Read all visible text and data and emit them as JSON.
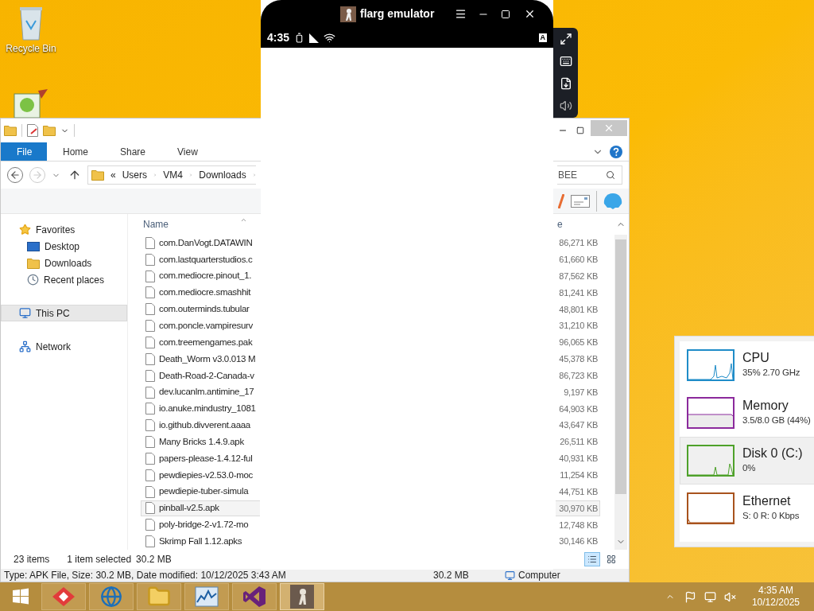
{
  "desktop": {
    "icons": [
      {
        "label": "Recycle Bin"
      }
    ]
  },
  "explorer": {
    "ribbon_tabs": [
      {
        "label": "File",
        "selected": true
      },
      {
        "label": "Home",
        "selected": false
      },
      {
        "label": "Share",
        "selected": false
      },
      {
        "label": "View",
        "selected": false
      }
    ],
    "address": {
      "overflow": "«",
      "parts": [
        "Users",
        "VM4",
        "Downloads"
      ]
    },
    "search": {
      "value": "BEE"
    },
    "nav": [
      {
        "label": "Favorites",
        "kind": "favorites",
        "selected": false,
        "children": [
          {
            "label": "Desktop",
            "kind": "desktop",
            "selected": false
          },
          {
            "label": "Downloads",
            "kind": "downloads",
            "selected": false
          },
          {
            "label": "Recent places",
            "kind": "recent",
            "selected": false
          }
        ]
      },
      {
        "label": "This PC",
        "kind": "pc",
        "selected": true
      },
      {
        "label": "Network",
        "kind": "network",
        "selected": false
      }
    ],
    "columns": {
      "name": "Name",
      "column_2": "e"
    },
    "files": [
      {
        "name": "com.DanVogt.DATAWIN",
        "size": "86,271 KB",
        "selected": false
      },
      {
        "name": "com.lastquarterstudios.c",
        "size": "61,660 KB",
        "selected": false
      },
      {
        "name": "com.mediocre.pinout_1.",
        "size": "87,562 KB",
        "selected": false
      },
      {
        "name": "com.mediocre.smashhit",
        "size": "81,241 KB",
        "selected": false
      },
      {
        "name": "com.outerminds.tubular",
        "size": "48,801 KB",
        "selected": false
      },
      {
        "name": "com.poncle.vampiresurv",
        "size": "31,210 KB",
        "selected": false
      },
      {
        "name": "com.treemengames.pak",
        "size": "96,065 KB",
        "selected": false
      },
      {
        "name": "Death_Worm v3.0.013 M",
        "size": "45,378 KB",
        "selected": false
      },
      {
        "name": "Death-Road-2-Canada-v",
        "size": "86,723 KB",
        "selected": false
      },
      {
        "name": "dev.lucanlm.antimine_17",
        "size": "9,197 KB",
        "selected": false
      },
      {
        "name": "io.anuke.mindustry_1081",
        "size": "64,903 KB",
        "selected": false
      },
      {
        "name": "io.github.divverent.aaaa",
        "size": "43,647 KB",
        "selected": false
      },
      {
        "name": "Many Bricks 1.4.9.apk",
        "size": "26,511 KB",
        "selected": false
      },
      {
        "name": "papers-please-1.4.12-ful",
        "size": "40,931 KB",
        "selected": false
      },
      {
        "name": "pewdiepies-v2.53.0-moc",
        "size": "11,254 KB",
        "selected": false
      },
      {
        "name": "pewdiepie-tuber-simula",
        "size": "44,751 KB",
        "selected": false
      },
      {
        "name": "pinball-v2.5.apk",
        "size": "30,970 KB",
        "selected": true
      },
      {
        "name": "poly-bridge-2-v1.72-mo",
        "size": "12,748 KB",
        "selected": false
      },
      {
        "name": "Skrimp Fall 1.12.apks",
        "size": "30,146 KB",
        "selected": false
      }
    ],
    "status": {
      "items": "23 items",
      "selection": "1 item selected",
      "size": "30.2 MB",
      "views": [
        {
          "kind": "details",
          "selected": true
        },
        {
          "kind": "tiles",
          "selected": false
        }
      ]
    },
    "details_bar": {
      "info": "Type: APK File, Size: 30.2 MB, Date modified: 10/12/2025 3:43 AM",
      "size": "30.2 MB",
      "location": "Computer"
    }
  },
  "emulator": {
    "title": "flarg emulator",
    "time": "4:35",
    "input_badge": "A"
  },
  "performance": [
    {
      "name": "CPU",
      "value": "35% 2.70 GHz",
      "color": "#1f8cc8",
      "selected": false
    },
    {
      "name": "Memory",
      "value": "3.5/8.0 GB (44%)",
      "color": "#8b2a9c",
      "selected": false
    },
    {
      "name": "Disk 0 (C:)",
      "value": "0%",
      "color": "#4ea12a",
      "selected": true
    },
    {
      "name": "Ethernet",
      "value": "S: 0 R: 0 Kbps",
      "color": "#a8531d",
      "selected": false
    }
  ],
  "taskbar": {
    "apps": [
      {
        "kind": "toolbox",
        "active": false
      },
      {
        "kind": "browser",
        "active": false
      },
      {
        "kind": "folder",
        "active": false
      },
      {
        "kind": "chart",
        "active": false
      },
      {
        "kind": "studio",
        "active": false
      },
      {
        "kind": "emulator",
        "active": true
      }
    ],
    "time": "4:35 AM",
    "date": "10/12/2025"
  }
}
